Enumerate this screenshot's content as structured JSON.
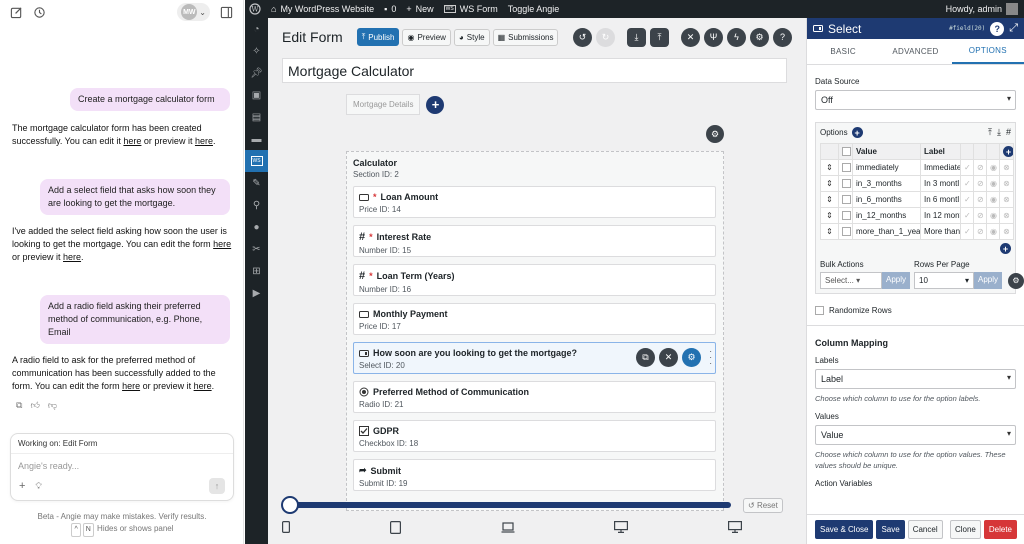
{
  "chat": {
    "avatar_initials": "MW",
    "messages": [
      {
        "role": "user",
        "text": "Create a mortgage calculator form"
      },
      {
        "role": "assistant",
        "text1": "The mortgage calculator form has been created successfully. You can edit it ",
        "link1": "here",
        "text2": " or preview it ",
        "link2": "here",
        "text3": "."
      },
      {
        "role": "user",
        "text": "Add a select field that asks how soon they are looking to get the mortgage."
      },
      {
        "role": "assistant",
        "text1": "I've added the select field asking how soon the user is looking to get the mortgage. You can edit the form ",
        "link1": "here",
        "text2": " or preview it ",
        "link2": "here",
        "text3": "."
      },
      {
        "role": "user",
        "text": "Add a radio field asking their preferred method of communication, e.g. Phone, Email"
      },
      {
        "role": "assistant",
        "text1": "A radio field to ask for the preferred method of communication has been successfully added to the form. You can edit the form ",
        "link1": "here",
        "text2": " or preview it ",
        "link2": "here",
        "text3": "."
      }
    ],
    "working_on_label": "Working on:",
    "working_on_value": "Edit Form",
    "input_placeholder": "Angie's ready...",
    "disclaimer": "Beta - Angie may make mistakes. Verify results.",
    "shortcut_keys": [
      "^",
      "N"
    ],
    "shortcut_text": "Hides or shows panel"
  },
  "wp_admin_bar": {
    "site_name": "My WordPress Website",
    "comments_count": "0",
    "new_label": "New",
    "ws_form_label": "WS Form",
    "toggle_label": "Toggle Angie",
    "howdy": "Howdy, admin"
  },
  "editor": {
    "title": "Edit Form",
    "buttons": {
      "publish": "Publish",
      "preview": "Preview",
      "style": "Style",
      "submissions": "Submissions"
    },
    "form_name": "Mortgage Calculator",
    "tab_label": "Mortgage Details",
    "section": {
      "title": "Calculator",
      "subtitle": "Section  ID: 2"
    },
    "fields": [
      {
        "icon": "price",
        "label": "Loan Amount",
        "required": true,
        "sub": "Price  ID: 14"
      },
      {
        "icon": "number",
        "label": "Interest Rate",
        "required": true,
        "sub": "Number  ID: 15"
      },
      {
        "icon": "number",
        "label": "Loan Term (Years)",
        "required": true,
        "sub": "Number  ID: 16"
      },
      {
        "icon": "price",
        "label": "Monthly Payment",
        "required": false,
        "sub": "Price  ID: 17"
      },
      {
        "icon": "select",
        "label": "How soon are you looking to get the mortgage?",
        "required": false,
        "sub": "Select  ID: 20",
        "selected": true
      },
      {
        "icon": "radio",
        "label": "Preferred Method of Communication",
        "required": false,
        "sub": "Radio  ID: 21"
      },
      {
        "icon": "checkbox",
        "label": "GDPR",
        "required": false,
        "sub": "Checkbox  ID: 18"
      },
      {
        "icon": "submit",
        "label": "Submit",
        "required": false,
        "sub": "Submit  ID: 19"
      }
    ],
    "required_marker": "*",
    "breakpoint_slider_fraction": 0,
    "reset_label": "Reset"
  },
  "sidebar": {
    "title": "Select",
    "field_id": "#field(20)",
    "tabs": [
      "BASIC",
      "ADVANCED",
      "OPTIONS"
    ],
    "active_tab": "OPTIONS",
    "data_source_label": "Data Source",
    "data_source_value": "Off",
    "options_label": "Options",
    "options_columns": [
      "Value",
      "Label"
    ],
    "options_rows": [
      {
        "value": "immediately",
        "label": "Immediate"
      },
      {
        "value": "in_3_months",
        "label": "In 3 montl"
      },
      {
        "value": "in_6_months",
        "label": "In 6 montl"
      },
      {
        "value": "in_12_months",
        "label": "In 12 mont"
      },
      {
        "value": "more_than_1_yea",
        "label": "More than"
      }
    ],
    "bulk_actions_label": "Bulk Actions",
    "bulk_select_value": "Select...",
    "rows_per_page_label": "Rows Per Page",
    "rows_per_page_value": "10",
    "apply_label": "Apply",
    "randomize_label": "Randomize Rows",
    "column_mapping_title": "Column Mapping",
    "labels_label": "Labels",
    "labels_value": "Label",
    "labels_hint": "Choose which column to use for the option labels.",
    "values_label": "Values",
    "values_value": "Value",
    "values_hint": "Choose which column to use for the option values. These values should be unique.",
    "action_variables_label": "Action Variables",
    "footer": {
      "save_close": "Save & Close",
      "save": "Save",
      "cancel": "Cancel",
      "clone": "Clone",
      "delete": "Delete"
    }
  },
  "colors": {
    "accent": "#1e3a72",
    "wp_dark": "#1d2327",
    "user_bubble": "#f3e0f8",
    "delete": "#d63638"
  }
}
